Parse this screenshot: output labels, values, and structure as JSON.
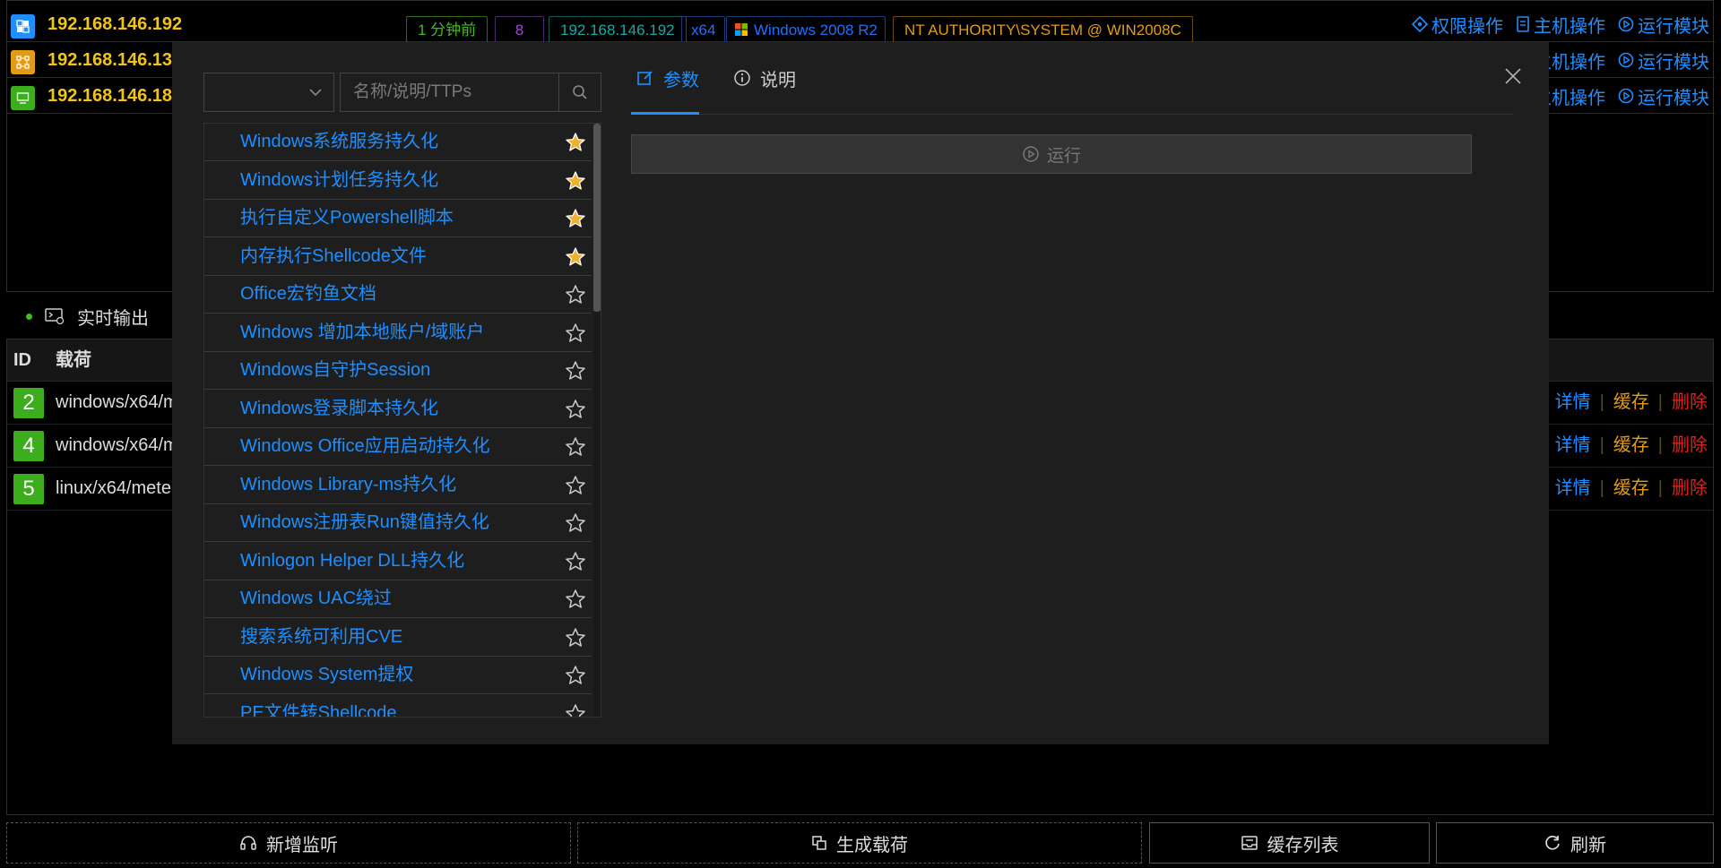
{
  "sessions": [
    {
      "ip": "192.168.146.192",
      "icon": "windows-icon",
      "icon_color": "#1f8fff",
      "tags": [
        {
          "text": "1 分钟前",
          "color": "#3cbf19"
        },
        {
          "text": "8",
          "color": "#9b4ad6"
        },
        {
          "text": "192.168.146.192",
          "color": "#17a9a5"
        },
        {
          "text": "x64",
          "color": "#1f6fff"
        },
        {
          "text": "Windows 2008 R2",
          "color": "#1f6fff"
        },
        {
          "text": "NT AUTHORITY\\SYSTEM @ WIN2008C",
          "color": "#e39b16"
        }
      ],
      "ops": [
        "权限操作",
        "主机操作",
        "运行模块"
      ]
    },
    {
      "ip": "192.168.146.13",
      "icon": "network-icon",
      "icon_color": "#e39b16",
      "ops": [
        "主机操作",
        "运行模块"
      ]
    },
    {
      "ip": "192.168.146.18",
      "icon": "monitor-icon",
      "icon_color": "#3cae1e",
      "ops": [
        "主机操作",
        "运行模块"
      ]
    }
  ],
  "output": {
    "tab_label": "实时输出",
    "headers": {
      "id": "ID",
      "payload": "载荷"
    },
    "rows": [
      {
        "id": "2",
        "payload": "windows/x64/m"
      },
      {
        "id": "4",
        "payload": "windows/x64/m"
      },
      {
        "id": "5",
        "payload": "linux/x64/mete"
      }
    ],
    "actions": {
      "detail": "详情",
      "cache": "缓存",
      "delete": "删除"
    }
  },
  "bottom_buttons": {
    "new_listener": "新增监听",
    "gen_payload": "生成载荷",
    "cache_list": "缓存列表",
    "refresh": "刷新"
  },
  "modal": {
    "search_placeholder": "名称/说明/TTPs",
    "tabs": {
      "params": "参数",
      "desc": "说明"
    },
    "run_label": "运行",
    "modules": [
      {
        "name": "Windows系统服务持久化",
        "fav": true
      },
      {
        "name": "Windows计划任务持久化",
        "fav": true
      },
      {
        "name": "执行自定义Powershell脚本",
        "fav": true
      },
      {
        "name": "内存执行Shellcode文件",
        "fav": true
      },
      {
        "name": "Office宏钓鱼文档",
        "fav": false
      },
      {
        "name": "Windows 增加本地账户/域账户",
        "fav": false
      },
      {
        "name": "Windows自守护Session",
        "fav": false
      },
      {
        "name": "Windows登录脚本持久化",
        "fav": false
      },
      {
        "name": "Windows Office应用启动持久化",
        "fav": false
      },
      {
        "name": "Windows Library-ms持久化",
        "fav": false
      },
      {
        "name": "Windows注册表Run键值持久化",
        "fav": false
      },
      {
        "name": "Winlogon Helper DLL持久化",
        "fav": false
      },
      {
        "name": "Windows UAC绕过",
        "fav": false
      },
      {
        "name": "搜索系统可利用CVE",
        "fav": false
      },
      {
        "name": "Windows System提权",
        "fav": false
      },
      {
        "name": "PE文件转Shellcode",
        "fav": false
      }
    ]
  }
}
